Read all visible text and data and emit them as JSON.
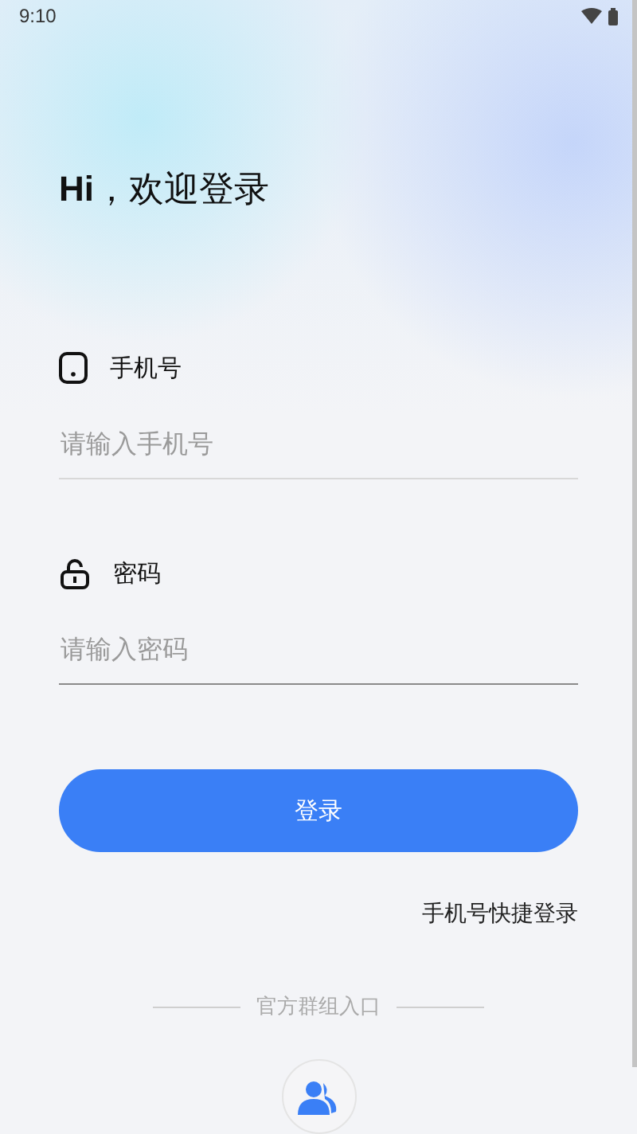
{
  "status_bar": {
    "time": "9:10"
  },
  "title": "**Hi**，欢迎登录",
  "fields": [
    {
      "kind": "phone",
      "label": "手机号",
      "placeholder": "请输入手机号",
      "focused": false
    },
    {
      "kind": "password",
      "label": "密码",
      "placeholder": "请输入密码",
      "focused": true
    }
  ],
  "login_button": "登录",
  "quick_login_link": "手机号快捷登录",
  "group_entry": {
    "label": "官方群组入口"
  }
}
